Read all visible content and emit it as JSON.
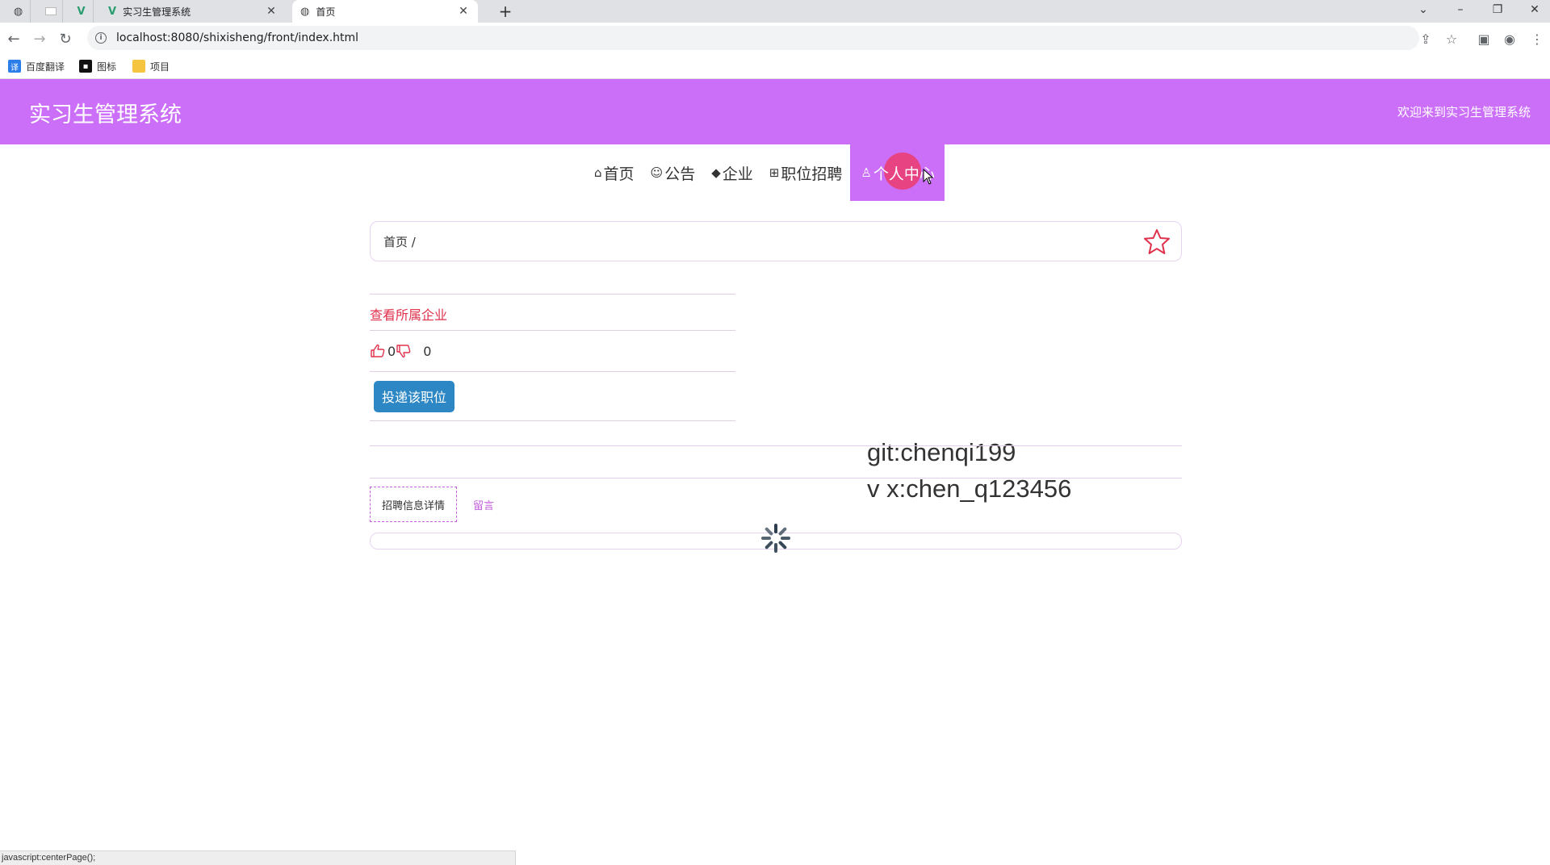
{
  "browser": {
    "tabs": [
      {
        "title": "实习生管理系统"
      },
      {
        "title": "首页"
      }
    ],
    "url": "localhost:8080/shixisheng/front/index.html",
    "bookmarks": [
      "百度翻译",
      "图标",
      "项目"
    ],
    "status_text": "javascript:centerPage();"
  },
  "header": {
    "title": "实习生管理系统",
    "welcome": "欢迎来到实习生管理系统"
  },
  "nav": {
    "items": [
      {
        "icon": "⌂",
        "label": "首页"
      },
      {
        "icon": "☺",
        "label": "公告"
      },
      {
        "icon": "◆",
        "label": "企业"
      },
      {
        "icon": "⊞",
        "label": "职位招聘"
      },
      {
        "icon": "♙",
        "label": "个人中心"
      }
    ]
  },
  "breadcrumb": {
    "text": "首页 /"
  },
  "job": {
    "company_link": "查看所属企业",
    "likes": "0",
    "dislikes": "0",
    "apply_label": "投递该职位"
  },
  "watermark": {
    "line1": "git:chenqi199",
    "line2": "v x:chen_q123456"
  },
  "detail_tabs": [
    "招聘信息详情",
    "留言"
  ],
  "colors": {
    "header": "#cc6ff8",
    "link": "#e0314c",
    "button": "#2c87c4"
  }
}
